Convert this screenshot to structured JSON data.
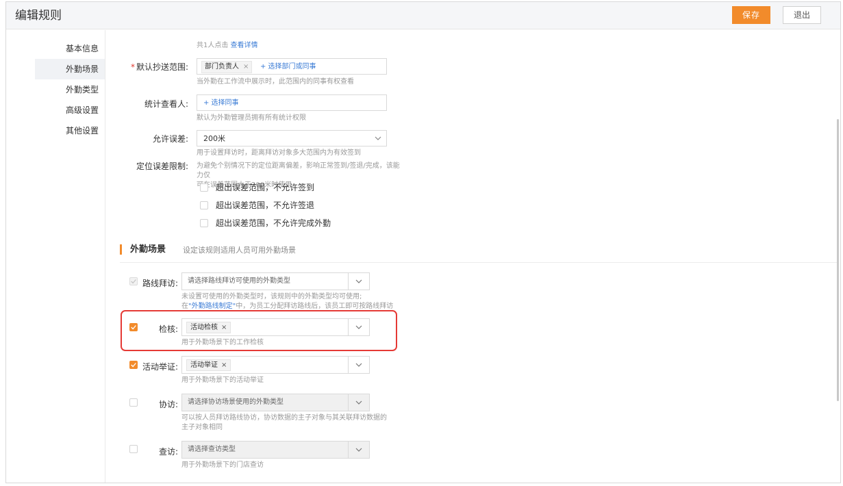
{
  "header": {
    "title": "编辑规则",
    "save_label": "保存",
    "exit_label": "退出"
  },
  "sidebar": {
    "items": [
      {
        "label": "基本信息",
        "active": false
      },
      {
        "label": "外勤场景",
        "active": true
      },
      {
        "label": "外勤类型",
        "active": false
      },
      {
        "label": "高级设置",
        "active": false
      },
      {
        "label": "其他设置",
        "active": false
      }
    ]
  },
  "top_hint": {
    "prefix": "共1人点击 ",
    "link": "查看详情"
  },
  "cc_scope": {
    "required_mark": "*",
    "label": "默认抄送范围:",
    "tag": "部门负责人",
    "tag_close": "×",
    "add_link": "+ 选择部门或同事",
    "hint": "当外勤在工作流中展示时，此范围内的同事有权查看"
  },
  "stat_viewer": {
    "label": "统计查看人:",
    "add_link": "+ 选择同事",
    "hint": "默认为外勤管理员拥有所有统计权限"
  },
  "tolerance": {
    "label": "允许误差:",
    "value": "200米",
    "hint": "用于设置拜访时，距离拜访对象多大范围内为有效签到"
  },
  "location_limit": {
    "label": "定位误差限制:",
    "hint_line1": "为避免个别情况下的定位距离偏差，影响正常签到/签退/完成，该能力仅",
    "hint_line2": "可在误差范围大于200米时使用",
    "options": [
      {
        "label": "超出误差范围，不允许签到",
        "checked": false
      },
      {
        "label": "超出误差范围，不允许签退",
        "checked": false
      },
      {
        "label": "超出误差范围，不允许完成外勤",
        "checked": false
      }
    ]
  },
  "section": {
    "title": "外勤场景",
    "desc": "设定该规则适用人员可用外勤场景"
  },
  "scenes": {
    "route_visit": {
      "label": "路线拜访:",
      "placeholder": "请选择路线拜访可使用的外勤类型",
      "hint_line1": "未设置可使用的外勤类型时，该规则中的外勤类型均可使用;",
      "hint_line2_prefix": "在",
      "hint_line2_link": "\"外勤路线制定\"",
      "hint_line2_suffix": "中，为员工分配拜访路线后，该员工即可按路线拜访"
    },
    "inspection": {
      "label": "检核:",
      "chip": "活动检核",
      "chip_close": "×",
      "hint": "用于外勤场景下的工作检核"
    },
    "activity_proof": {
      "label": "活动举证:",
      "chip": "活动举证",
      "chip_close": "×",
      "hint": "用于外勤场景下的活动举证"
    },
    "co_visit": {
      "label": "协访:",
      "placeholder": "请选择协访场景使用的外勤类型",
      "hint_line1": "可以按人员拜访路线协访，协访数据的主子对象与其关联拜访数据的",
      "hint_line2": "主子对象相同"
    },
    "check_visit": {
      "label": "查访:",
      "placeholder": "请选择查访类型",
      "hint": "用于外勤场景下的门店查访"
    }
  },
  "colors": {
    "accent": "#f28b2b",
    "link": "#3a7bd5",
    "highlight": "#e53935"
  }
}
